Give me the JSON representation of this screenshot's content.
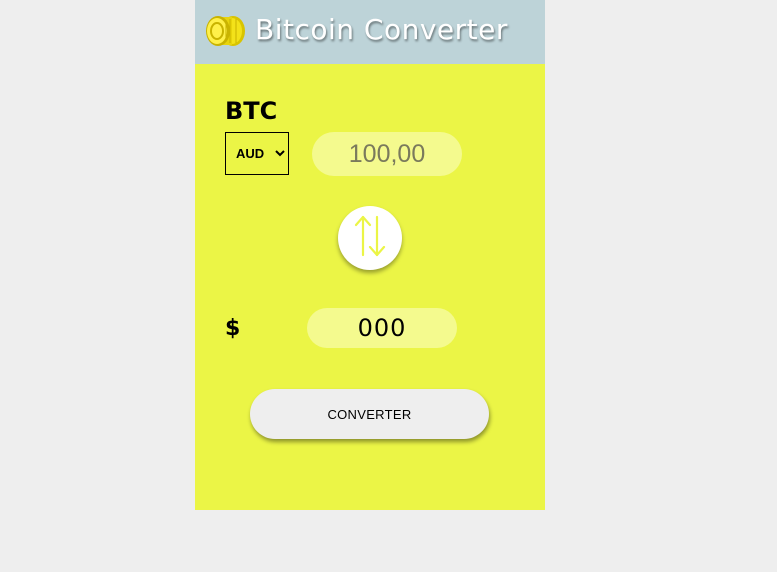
{
  "header": {
    "title": "Bitcoin Converter",
    "logo_icon": "bitcoin-coins-icon"
  },
  "converter": {
    "from_label": "BTC",
    "currency_selected": "AUD",
    "amount_value": "100,00",
    "swap_icon": "swap-vertical-arrows-icon",
    "to_label": "$",
    "result_value": "000",
    "convert_label": "CONVERTER"
  },
  "colors": {
    "panel": "#ebf546",
    "header": "#bdd3d8",
    "input_bg": "#f4fa8e",
    "page_bg": "#eeeeee"
  }
}
